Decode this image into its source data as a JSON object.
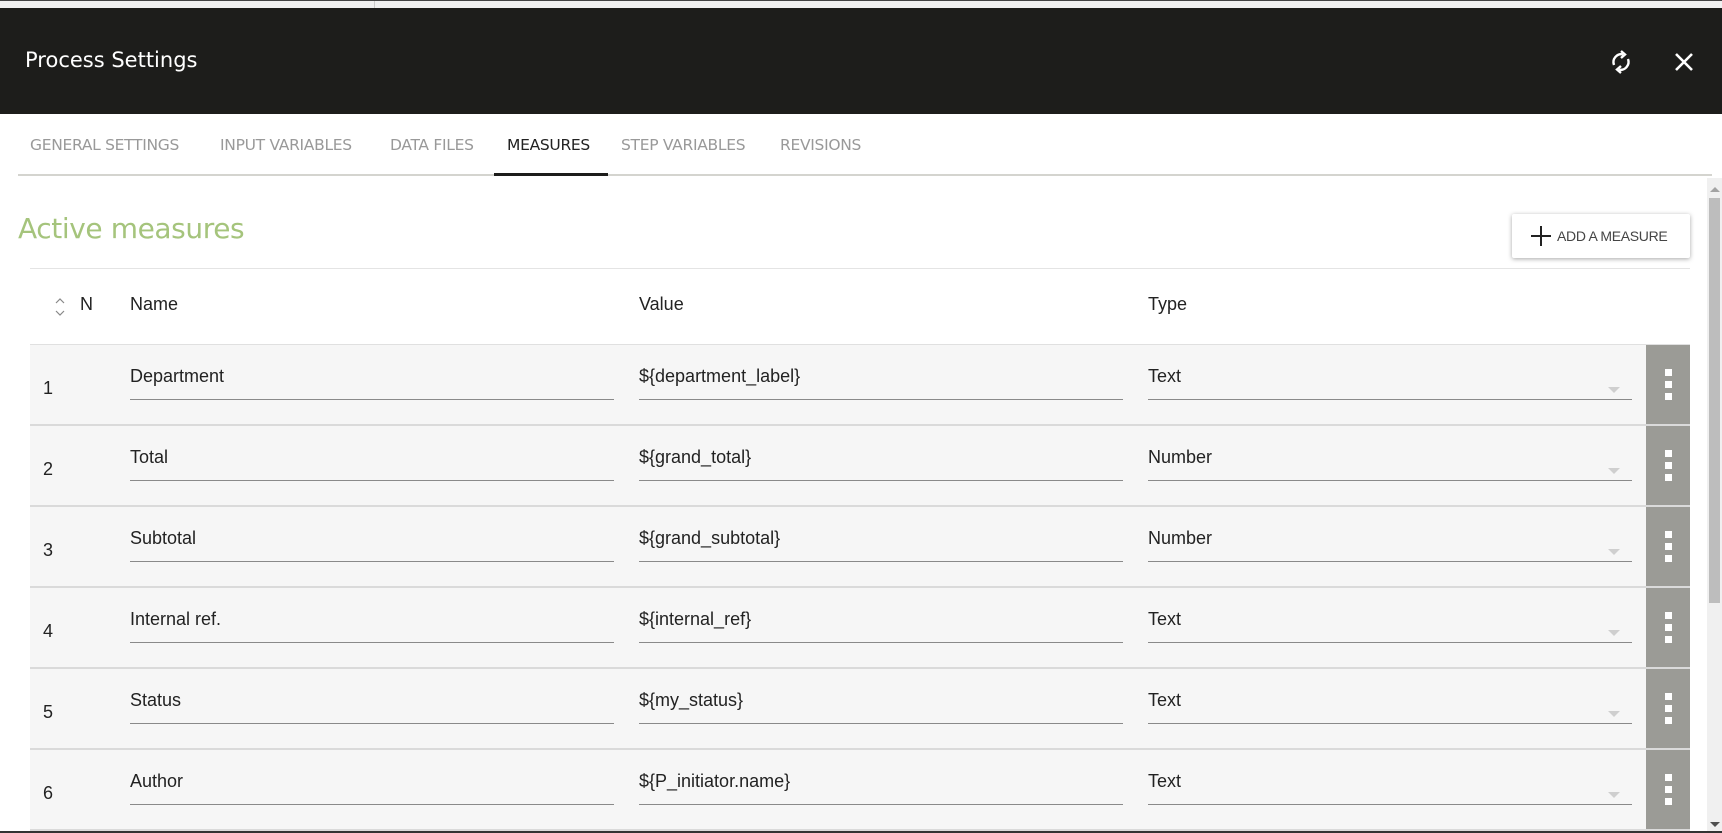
{
  "header": {
    "title": "Process Settings",
    "refresh_icon": "refresh-icon",
    "close_icon": "close-icon"
  },
  "tabs": [
    {
      "label": "GENERAL SETTINGS",
      "active": false
    },
    {
      "label": "INPUT VARIABLES",
      "active": false
    },
    {
      "label": "DATA FILES",
      "active": false
    },
    {
      "label": "MEASURES",
      "active": true
    },
    {
      "label": "STEP VARIABLES",
      "active": false
    },
    {
      "label": "REVISIONS",
      "active": false
    }
  ],
  "section": {
    "title": "Active measures",
    "add_button_label": "ADD A MEASURE",
    "add_button_icon": "plus-icon"
  },
  "table": {
    "columns": {
      "n": "N",
      "name": "Name",
      "value": "Value",
      "type": "Type"
    },
    "sort_icon": "sort-icon",
    "rows": [
      {
        "n": "1",
        "name": "Department",
        "value": "${department_label}",
        "type": "Text"
      },
      {
        "n": "2",
        "name": "Total",
        "value": "${grand_total}",
        "type": "Number"
      },
      {
        "n": "3",
        "name": "Subtotal",
        "value": "${grand_subtotal}",
        "type": "Number"
      },
      {
        "n": "4",
        "name": "Internal ref.",
        "value": "${internal_ref}",
        "type": "Text"
      },
      {
        "n": "5",
        "name": "Status",
        "value": "${my_status}",
        "type": "Text"
      },
      {
        "n": "6",
        "name": "Author",
        "value": "${P_initiator.name}",
        "type": "Text"
      }
    ]
  },
  "colors": {
    "header_bg": "#1d1d1b",
    "section_title": "#a5c47c",
    "row_menu_bg": "#9b9b96"
  }
}
